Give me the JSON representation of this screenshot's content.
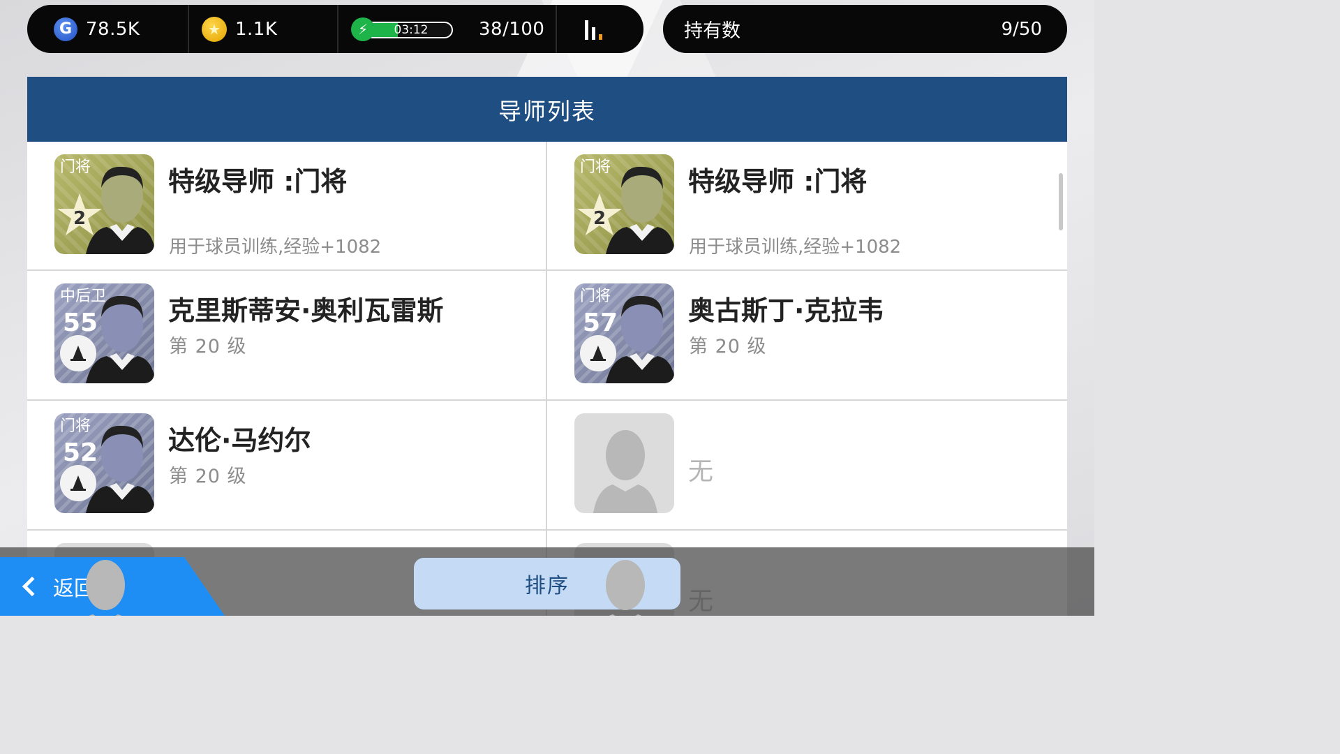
{
  "resources": {
    "g_points": "78.5K",
    "coins": "1.1K",
    "stamina_timer": "03:12",
    "stamina_value": "38/100",
    "stamina_fraction": 0.38
  },
  "holdings": {
    "label": "持有数",
    "value": "9/50"
  },
  "panel": {
    "title": "导师列表"
  },
  "items": [
    {
      "type": "trainer",
      "position": "门将",
      "rank": "2",
      "name": "特级导师 :门将",
      "desc": "用于球员训练,经验+1082"
    },
    {
      "type": "trainer",
      "position": "门将",
      "rank": "2",
      "name": "特级导师 :门将",
      "desc": "用于球员训练,经验+1082"
    },
    {
      "type": "coach",
      "position": "中后卫",
      "rating": "55",
      "name": "克里斯蒂安·奥利瓦雷斯",
      "level": "第 20 级"
    },
    {
      "type": "coach",
      "position": "门将",
      "rating": "57",
      "name": "奥古斯丁·克拉韦",
      "level": "第 20 级"
    },
    {
      "type": "coach",
      "position": "门将",
      "rating": "52",
      "name": "达伦·马约尔",
      "level": "第 20 级"
    },
    {
      "type": "empty",
      "label": "无"
    },
    {
      "type": "empty",
      "label": ""
    },
    {
      "type": "empty",
      "label": "无"
    }
  ],
  "footer": {
    "back_label": "返回",
    "sort_label": "排序"
  },
  "colors": {
    "header_blue": "#1f4f82",
    "back_button_blue": "#1e8ef5",
    "stamina_green": "#1fb44a"
  }
}
